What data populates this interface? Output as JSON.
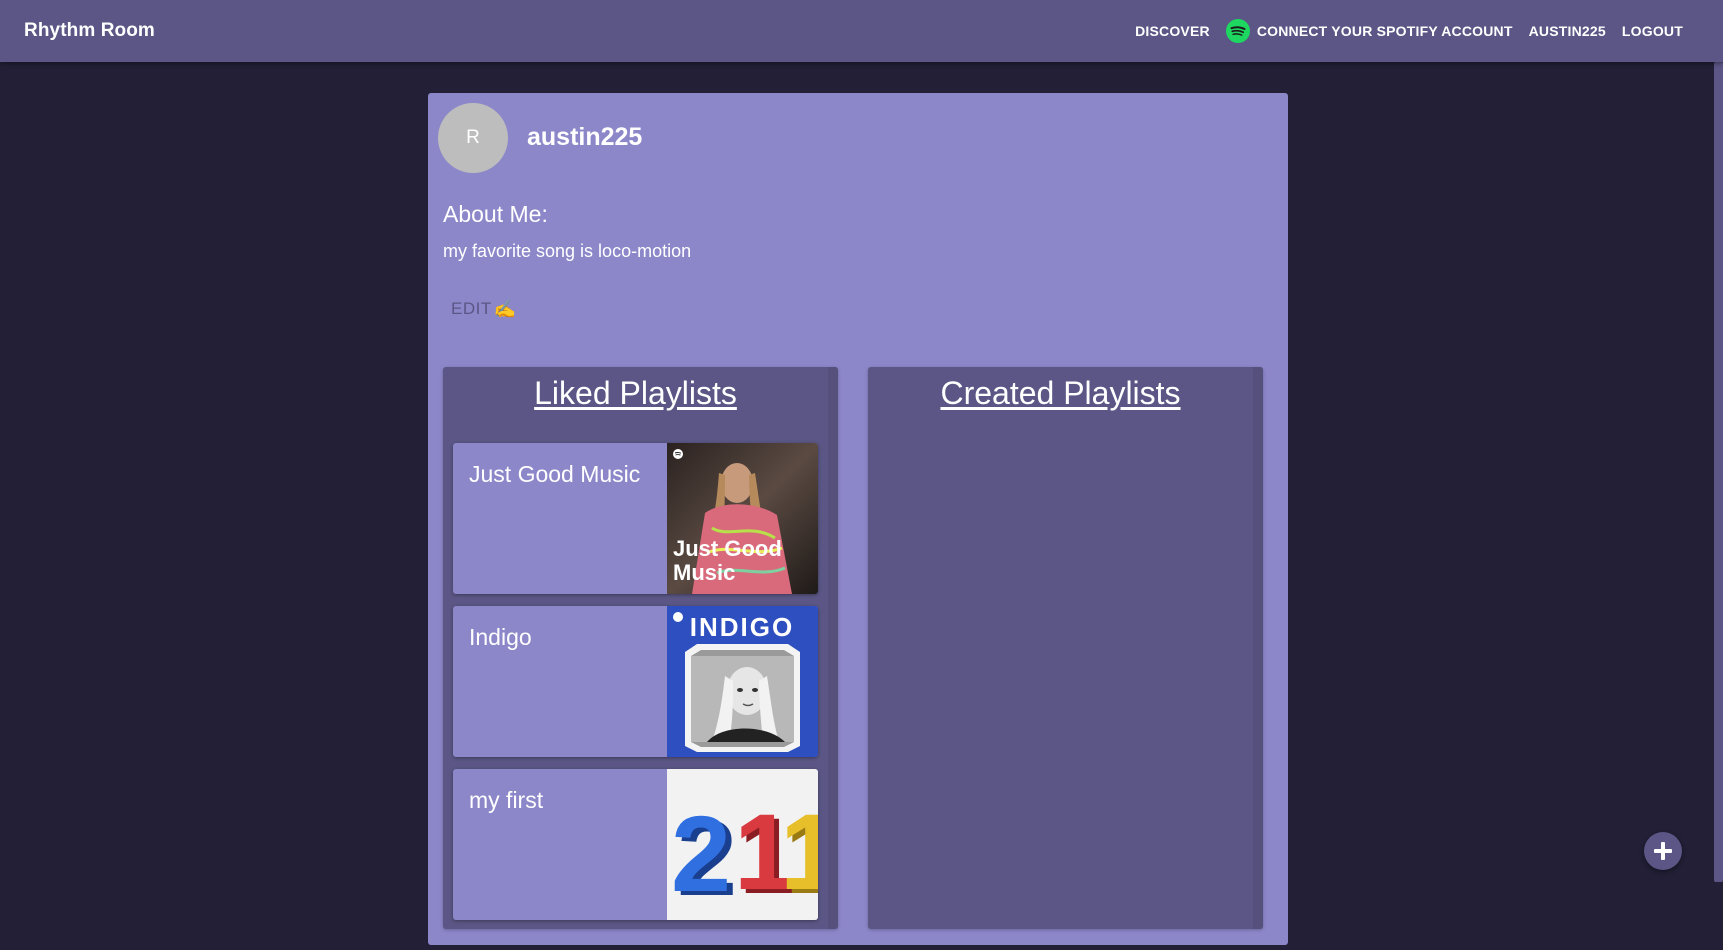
{
  "navbar": {
    "brand": "Rhythm Room",
    "links": {
      "discover": "DISCOVER",
      "spotify": "CONNECT YOUR SPOTIFY ACCOUNT",
      "user": "AUSTIN225",
      "logout": "LOGOUT"
    }
  },
  "profile": {
    "avatar_initial": "R",
    "username": "austin225",
    "about_heading": "About Me:",
    "about_text": "my favorite song is loco-motion",
    "edit_label": "EDIT",
    "edit_emoji": "✍️"
  },
  "liked_playlists": {
    "title": "Liked Playlists",
    "items": [
      {
        "name": "Just Good Music",
        "art_text": "Just Good Music",
        "art_color": "#4a3a35"
      },
      {
        "name": "Indigo",
        "art_text": "INDIGO",
        "art_color": "#2d4fc0"
      },
      {
        "name": "my first",
        "art_text": "211",
        "art_color": "#f2f2f2"
      }
    ]
  },
  "created_playlists": {
    "title": "Created Playlists",
    "items": []
  },
  "colors": {
    "background": "#221f36",
    "navbar": "#5b5685",
    "card": "#8c87c9",
    "panel": "#5b5685",
    "spotify_green": "#1ed760"
  },
  "icons": {
    "spotify": "spotify-icon",
    "add": "plus-icon",
    "avatar": "avatar"
  }
}
